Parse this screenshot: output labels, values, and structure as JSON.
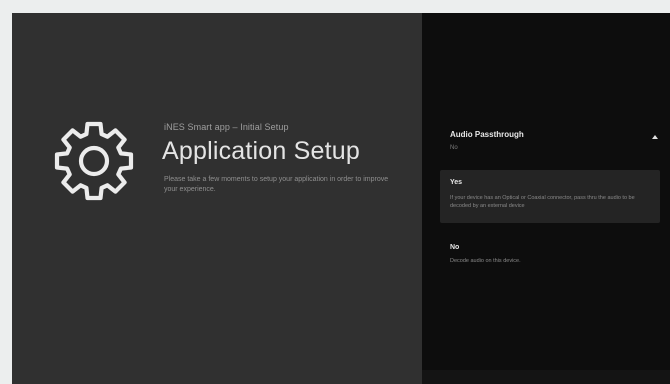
{
  "setup": {
    "icon": "gear-icon",
    "subtitle": "iNES Smart app – Initial Setup",
    "title": "Application Setup",
    "description": "Please take a few moments to setup your application in order to improve your experience."
  },
  "setting": {
    "title": "Audio Passthrough",
    "value": "No",
    "expand_icon": "caret-up-icon",
    "options": [
      {
        "label": "Yes",
        "description": "If your device has an Optical or Coaxial connector, pass thru the audio to be decoded by an external device",
        "selected": true
      },
      {
        "label": "No",
        "description": "Decode audio on this device.",
        "selected": false
      }
    ]
  },
  "colors": {
    "left_background": "#303030",
    "right_background": "#0d0d0d",
    "selected_option": "#242424"
  }
}
